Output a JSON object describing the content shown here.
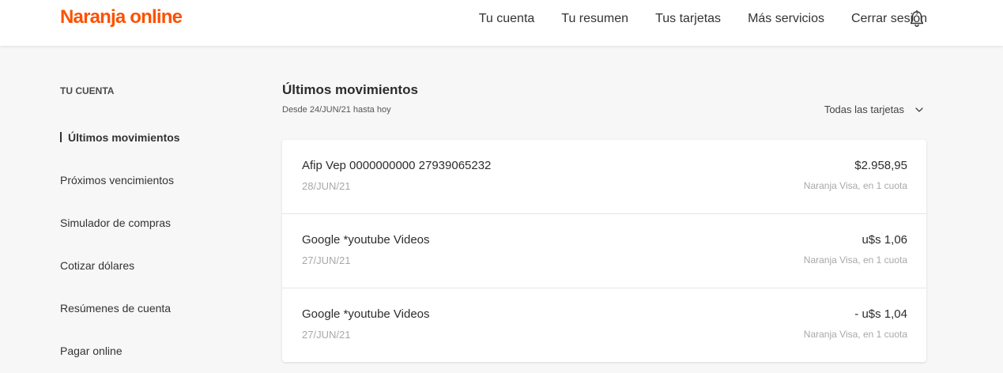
{
  "header": {
    "logo": "Naranja online",
    "nav": [
      "Tu cuenta",
      "Tu resumen",
      "Tus tarjetas",
      "Más servicios",
      "Cerrar sesión"
    ],
    "bell_icon": "bell-icon"
  },
  "sidebar": {
    "heading": "TU CUENTA",
    "items": [
      {
        "label": "Últimos movimientos"
      },
      {
        "label": "Próximos vencimientos"
      },
      {
        "label": "Simulador de compras"
      },
      {
        "label": "Cotizar dólares"
      },
      {
        "label": "Resúmenes de cuenta"
      },
      {
        "label": "Pagar online"
      }
    ]
  },
  "main": {
    "title": "Últimos movimientos",
    "subtitle": "Desde 24/JUN/21 hasta hoy",
    "card_filter": "Todas las tarjetas",
    "movements": [
      {
        "description": "Afip Vep 0000000000 27939065232",
        "date": "28/JUN/21",
        "amount": "$2.958,95",
        "card": "Naranja Visa, en 1 cuota"
      },
      {
        "description": "Google *youtube Videos",
        "date": "27/JUN/21",
        "amount": "u$s 1,06",
        "card": "Naranja Visa, en 1 cuota"
      },
      {
        "description": "Google *youtube Videos",
        "date": "27/JUN/21",
        "amount": "- u$s 1,04",
        "card": "Naranja Visa, en 1 cuota"
      }
    ]
  },
  "colors": {
    "brand": "#fe5000",
    "background": "#f7f7f7",
    "text": "#2c2c2c",
    "muted": "#a8a8a8"
  }
}
